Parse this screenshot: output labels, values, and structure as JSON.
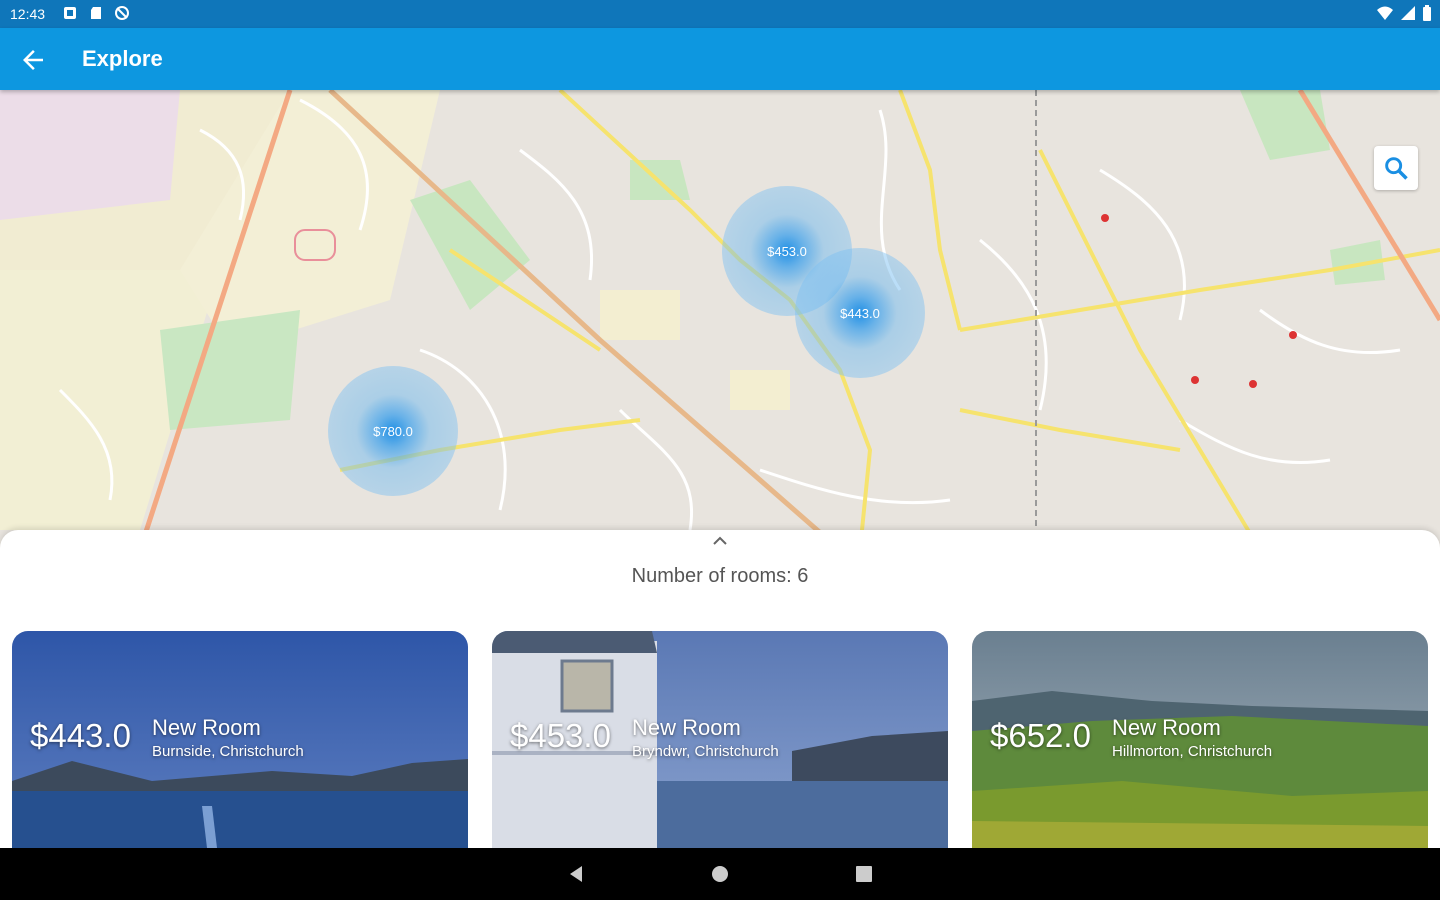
{
  "status_bar": {
    "time": "12:43"
  },
  "app_bar": {
    "title": "Explore"
  },
  "map": {
    "clusters": [
      {
        "label": "$453.0"
      },
      {
        "label": "$443.0"
      },
      {
        "label": "$780.0"
      }
    ]
  },
  "sheet": {
    "room_count": "Number of rooms: 6"
  },
  "cards": [
    {
      "price": "$443.0",
      "title": "New Room",
      "location": "Burnside, Christchurch"
    },
    {
      "price": "$453.0",
      "title": "New Room",
      "location": "Bryndwr, Christchurch"
    },
    {
      "price": "$652.0",
      "title": "New Room",
      "location": "Hillmorton, Christchurch"
    }
  ],
  "colors": {
    "status_bar": "#0f76ba",
    "app_bar": "#0d97e0",
    "cluster": "#1e8de6"
  }
}
